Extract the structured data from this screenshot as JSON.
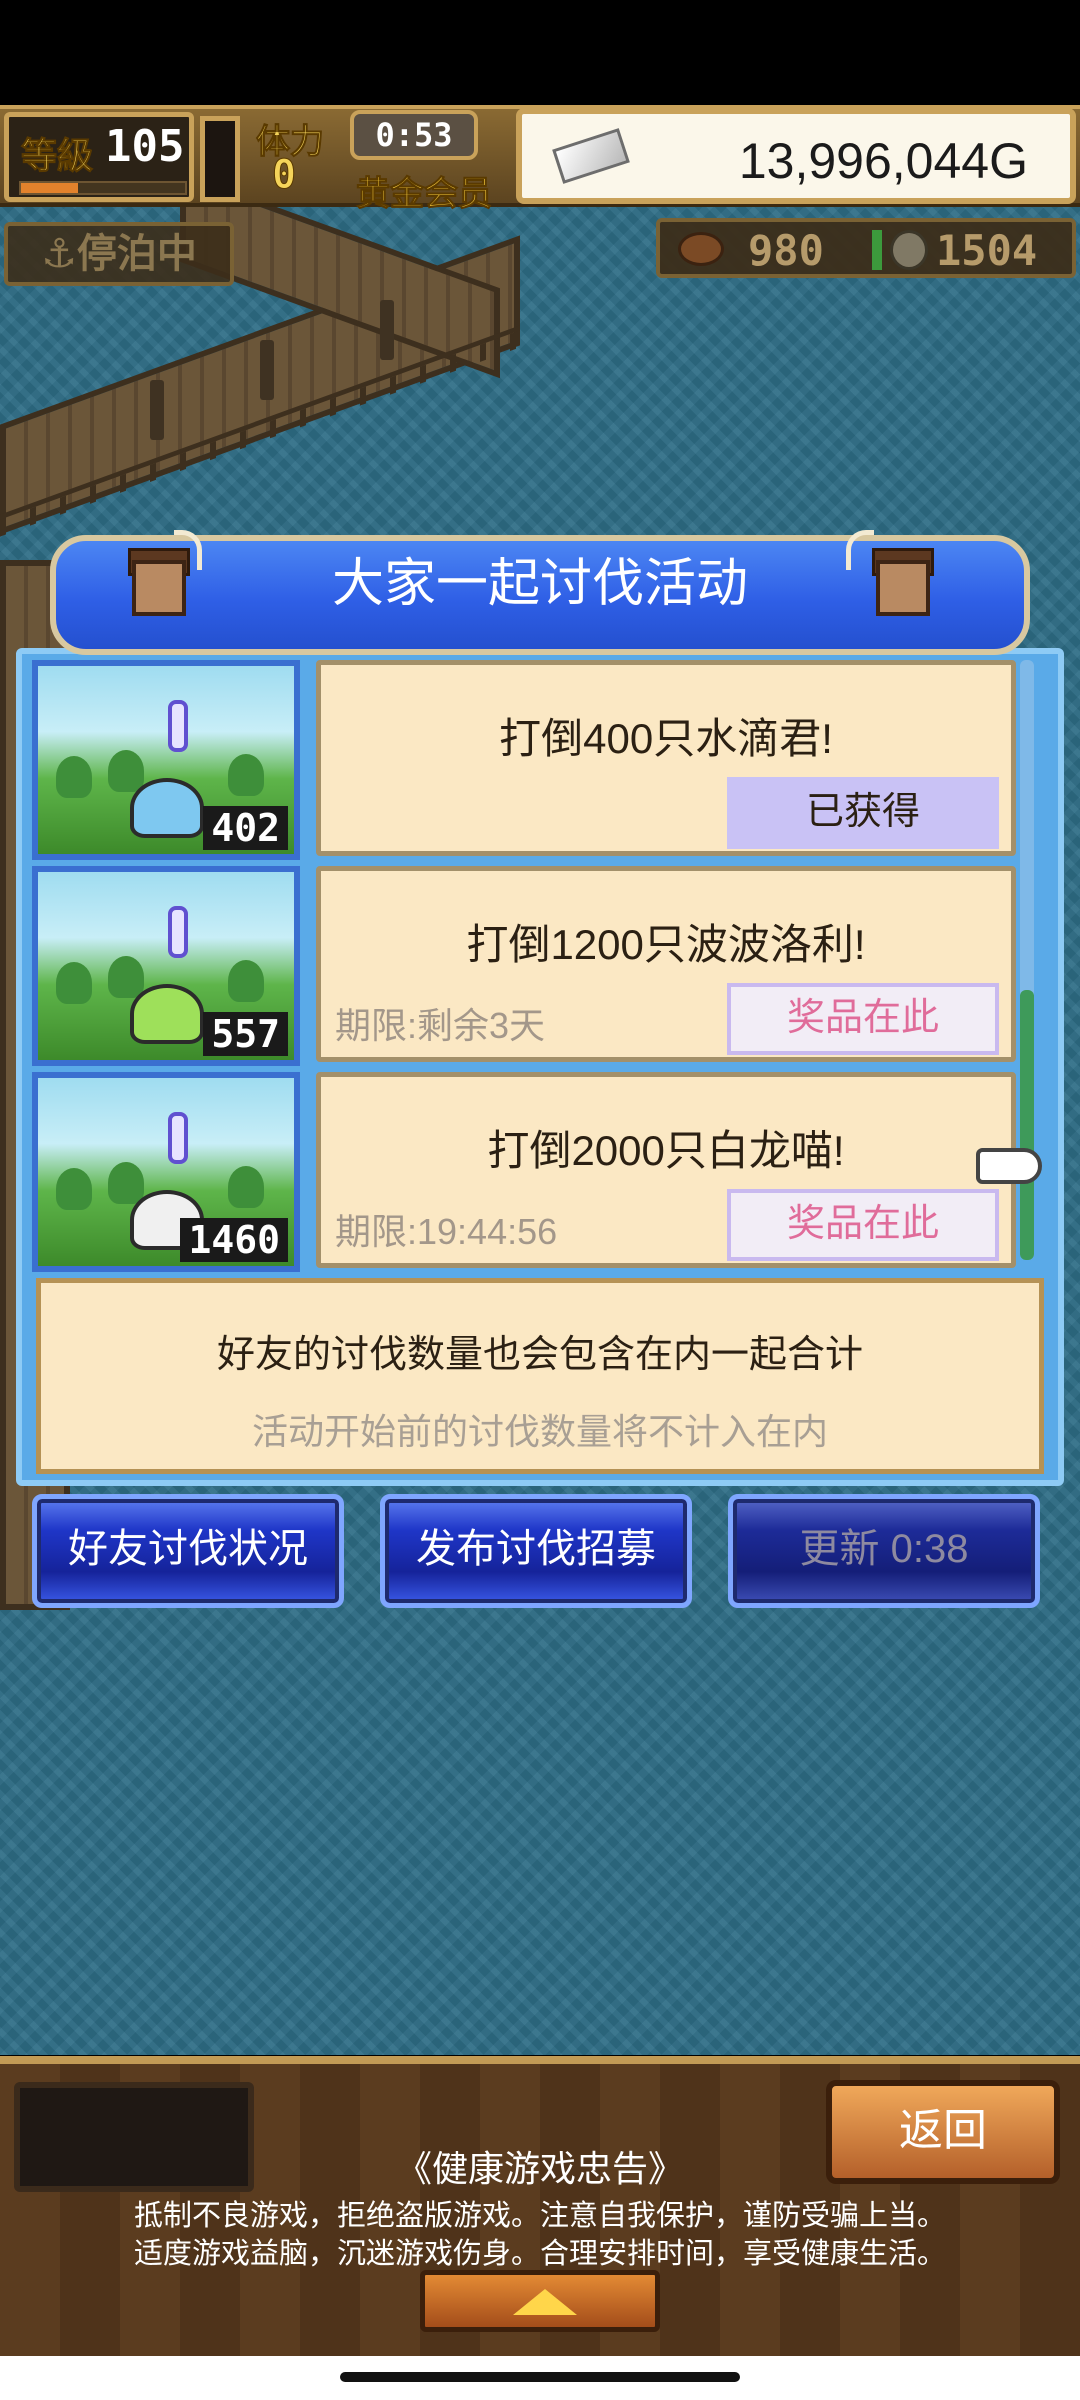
{
  "hud": {
    "level_label": "等級",
    "level": "105",
    "stamina_label": "体力",
    "stamina": "0",
    "timer": "0:53",
    "membership": "黄金会员",
    "gold": "13,996,044G",
    "status": "停泊中",
    "resource_a": "980",
    "resource_b": "1504",
    "level_progress": 0.35
  },
  "event": {
    "title": "大家一起讨伐活动",
    "missions": [
      {
        "count": "402",
        "title": "打倒400只水滴君!",
        "deadline": "",
        "button": "已获得",
        "claimed": true,
        "mob_color": "#7ec8f0"
      },
      {
        "count": "557",
        "title": "打倒1200只波波洛利!",
        "deadline": "期限:剩余3天",
        "button": "奖品在此",
        "claimed": false,
        "mob_color": "#9ee05a"
      },
      {
        "count": "1460",
        "title": "打倒2000只白龙喵!",
        "deadline": "期限:19:44:56",
        "button": "奖品在此",
        "claimed": false,
        "mob_color": "#f0f0f0"
      }
    ],
    "note_main": "好友的讨伐数量也会包含在内一起合计",
    "note_sub": "活动开始前的讨伐数量将不计入在内"
  },
  "actions": {
    "friend_status": "好友讨伐状况",
    "post_recruit": "发布讨伐招募",
    "refresh": "更新 0:38"
  },
  "footer": {
    "back": "返回",
    "advice_title": "《健康游戏忠告》",
    "advice_line1": "抵制不良游戏，拒绝盗版游戏。注意自我保护，谨防受骗上当。",
    "advice_line2": "适度游戏益脑，沉迷游戏伤身。合理安排时间，享受健康生活。"
  }
}
